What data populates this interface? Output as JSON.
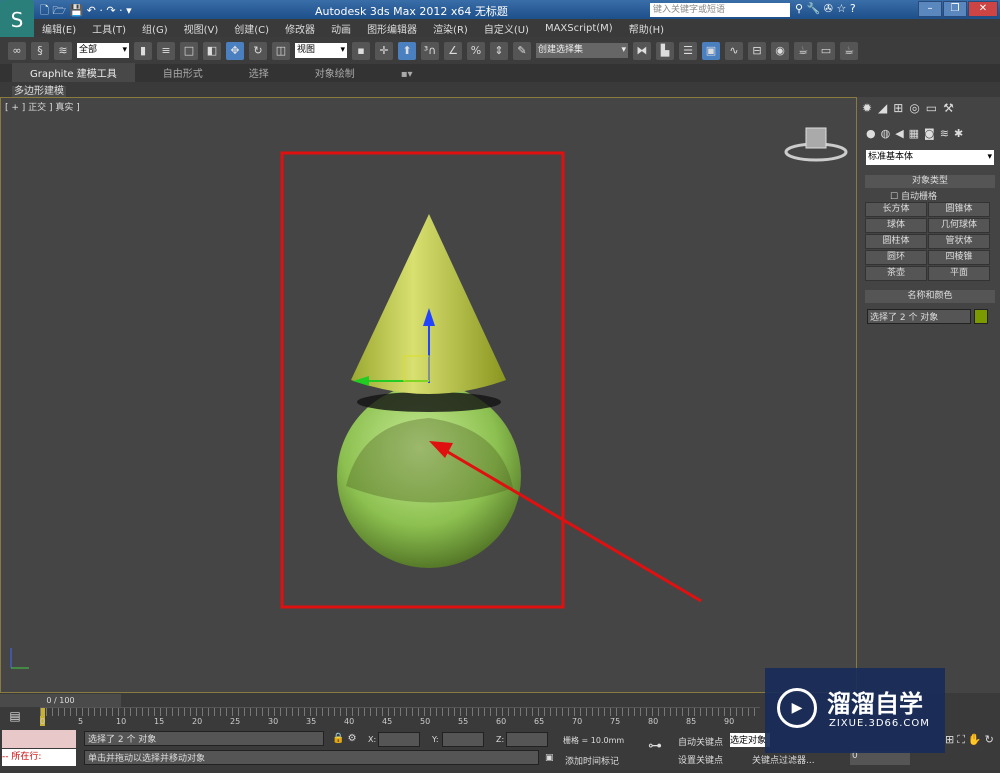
{
  "window": {
    "title": "Autodesk 3ds Max  2012 x64     无标题",
    "search_placeholder": "键入关键字或短语"
  },
  "menu": [
    "编辑(E)",
    "工具(T)",
    "组(G)",
    "视图(V)",
    "创建(C)",
    "修改器",
    "动画",
    "图形编辑器",
    "渲染(R)",
    "自定义(U)",
    "MAXScript(M)",
    "帮助(H)"
  ],
  "toolbar": {
    "selection_filter": "全部",
    "reference_coord": "视图",
    "named_selection": "创建选择集"
  },
  "ribbon": {
    "tabs": [
      "Graphite 建模工具",
      "自由形式",
      "选择",
      "对象绘制"
    ],
    "sub": "多边形建模"
  },
  "viewport": {
    "label": "[ + ] 正交 ] 真实 ]",
    "highlight_color": "#e01010"
  },
  "panel": {
    "category": "标准基本体",
    "object_type_header": "对象类型",
    "autogrid": "自动栅格",
    "buttons": [
      "长方体",
      "圆锥体",
      "球体",
      "几何球体",
      "圆柱体",
      "管状体",
      "圆环",
      "四棱锥",
      "茶壶",
      "平面"
    ],
    "name_color_header": "名称和颜色",
    "name_value": "选择了 2 个 对象",
    "object_color": "#7a9a00"
  },
  "timeline": {
    "frame": "0 / 100",
    "ticks": [
      "0",
      "5",
      "10",
      "15",
      "20",
      "25",
      "30",
      "35",
      "40",
      "45",
      "50",
      "55",
      "60",
      "65",
      "70",
      "75",
      "80",
      "85",
      "90"
    ]
  },
  "status": {
    "selection": "选择了 2 个 对象",
    "prompt": "单击并拖动以选择并移动对象",
    "script_label": "所在行:",
    "x_label": "X:",
    "y_label": "Y:",
    "z_label": "Z:",
    "grid": "栅格 = 10.0mm",
    "add_time_tag": "添加时间标记",
    "auto_key": "自动关键点",
    "set_key": "设置关键点",
    "key_mode": "选定对象",
    "key_filters": "关键点过滤器...",
    "current_frame": "0"
  },
  "watermark": {
    "name": "溜溜自学",
    "url": "ZIXUE.3D66.COM"
  }
}
